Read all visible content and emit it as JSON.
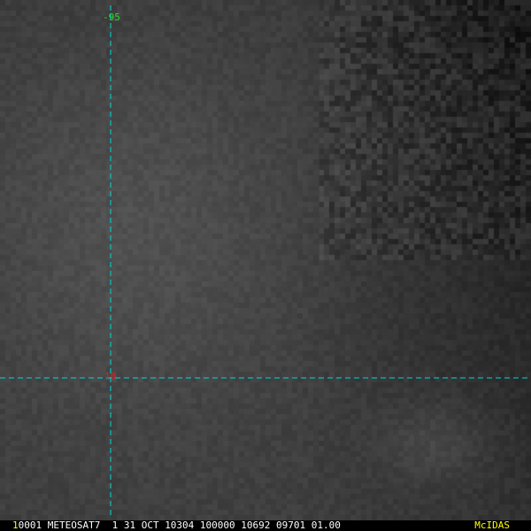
{
  "image": {
    "type": "grayscale satellite image",
    "satellite": "METEOSAT7",
    "crosshair_color": "#00d8d8"
  },
  "overlay": {
    "longitude_label": "-95",
    "latitude_label": "10",
    "longitude_color": "#22dd22",
    "latitude_color": "#dd2222"
  },
  "status_bar": {
    "frame": "1",
    "text": "0001 METEOSAT7  1 31 OCT 10304 100000 10692 09701 01.00",
    "brand": "McIDAS"
  }
}
